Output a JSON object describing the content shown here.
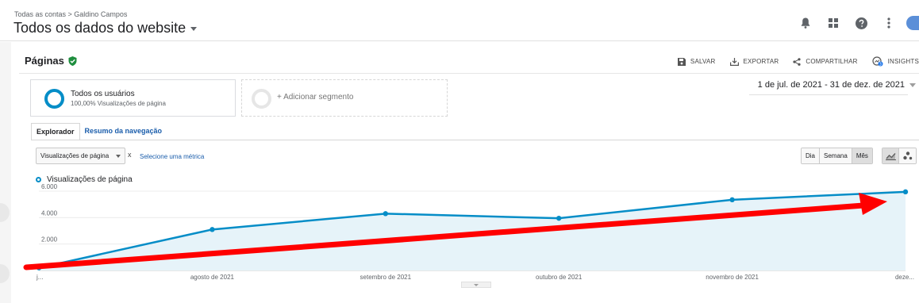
{
  "header": {
    "breadcrumb": "Todas as contas > Galdino Campos",
    "property_title": "Todos os dados do website",
    "icons": [
      "bell-icon",
      "apps-grid-icon",
      "help-icon",
      "more-vert-icon",
      "avatar"
    ]
  },
  "page": {
    "title": "Páginas",
    "verified_icon": "verified-shield-icon",
    "actions": [
      {
        "label": "SALVAR",
        "icon": "save-icon"
      },
      {
        "label": "EXPORTAR",
        "icon": "export-icon"
      },
      {
        "label": "COMPARTILHAR",
        "icon": "share-icon"
      },
      {
        "label": "INSIGHTS",
        "icon": "insights-icon"
      }
    ]
  },
  "segments": {
    "active": {
      "name": "Todos os usuários",
      "detail": "100,00% Visualizações de página"
    },
    "add_label": "+ Adicionar segmento"
  },
  "date_range": "1 de jul. de 2021 - 31 de dez. de 2021",
  "tabs": [
    {
      "label": "Explorador",
      "active": true
    },
    {
      "label": "Resumo da navegação",
      "active": false
    }
  ],
  "metric": {
    "selected": "Visualizações de página",
    "remove": "x",
    "select_link": "Selecione uma métrica"
  },
  "granularity": {
    "options": [
      "Dia",
      "Semana",
      "Mês"
    ],
    "selected": "Mês"
  },
  "chart_types": [
    "line-chart-icon",
    "motion-chart-icon"
  ],
  "colors": {
    "series": "#058dc7",
    "area_fill": "#e6f3f9",
    "annotation_arrow": "#ff0000"
  },
  "chart_data": {
    "type": "area",
    "x": [
      "j...",
      "agosto de 2021",
      "setembro de 2021",
      "outubro de 2021",
      "novembro de 2021",
      "deze..."
    ],
    "series": [
      {
        "name": "Visualizações de página",
        "values": [
          200,
          3100,
          4300,
          3950,
          5350,
          5950
        ]
      }
    ],
    "y_ticks": [
      "2.000",
      "4.000",
      "6.000"
    ],
    "ylim": [
      0,
      6000
    ],
    "grid": true,
    "legend": "top-left",
    "annotation": "red upward trend arrow"
  }
}
